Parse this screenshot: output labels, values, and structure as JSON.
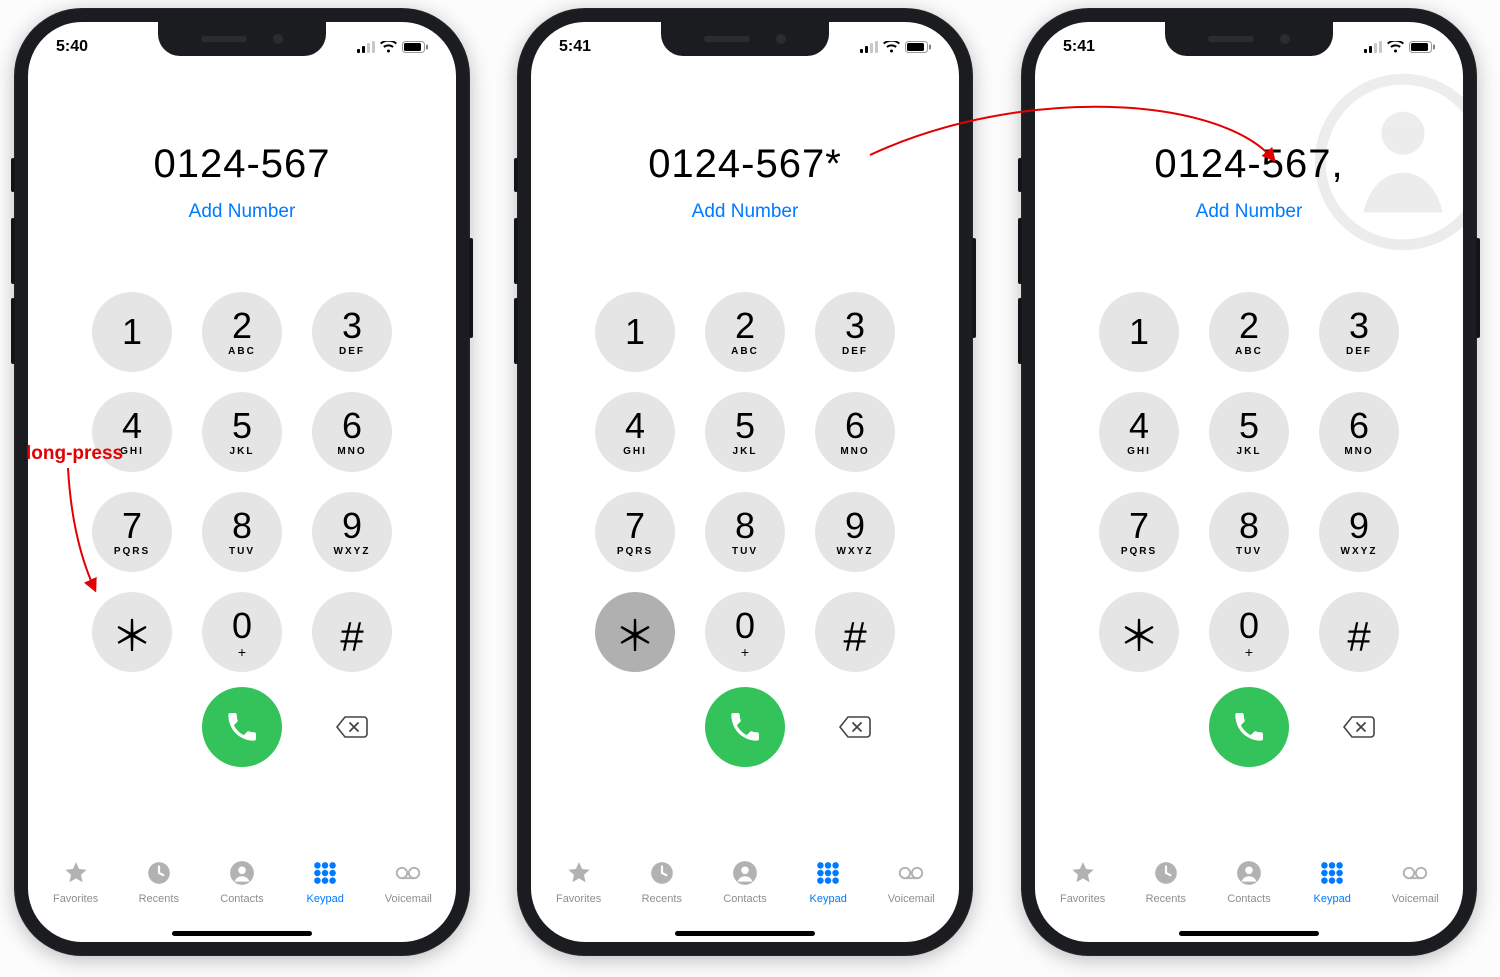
{
  "annotations": {
    "long_press_label": "long-press"
  },
  "phones": [
    {
      "status_time": "5:40",
      "dialed": "0124-567",
      "add_number_label": "Add Number",
      "star_pressed": false
    },
    {
      "status_time": "5:41",
      "dialed": "0124-567*",
      "add_number_label": "Add Number",
      "star_pressed": true
    },
    {
      "status_time": "5:41",
      "dialed": "0124-567,",
      "add_number_label": "Add Number",
      "star_pressed": false
    }
  ],
  "keypad": [
    {
      "digit": "1",
      "letters": ""
    },
    {
      "digit": "2",
      "letters": "ABC"
    },
    {
      "digit": "3",
      "letters": "DEF"
    },
    {
      "digit": "4",
      "letters": "GHI"
    },
    {
      "digit": "5",
      "letters": "JKL"
    },
    {
      "digit": "6",
      "letters": "MNO"
    },
    {
      "digit": "7",
      "letters": "PQRS"
    },
    {
      "digit": "8",
      "letters": "TUV"
    },
    {
      "digit": "9",
      "letters": "WXYZ"
    },
    {
      "digit": "*",
      "letters": "",
      "symbol": true
    },
    {
      "digit": "0",
      "letters": "+",
      "zero": true
    },
    {
      "digit": "#",
      "letters": "",
      "symbol": true
    }
  ],
  "tabs": [
    {
      "id": "favorites",
      "label": "Favorites",
      "active": false
    },
    {
      "id": "recents",
      "label": "Recents",
      "active": false
    },
    {
      "id": "contacts",
      "label": "Contacts",
      "active": false
    },
    {
      "id": "keypad",
      "label": "Keypad",
      "active": true
    },
    {
      "id": "voicemail",
      "label": "Voicemail",
      "active": false
    }
  ]
}
